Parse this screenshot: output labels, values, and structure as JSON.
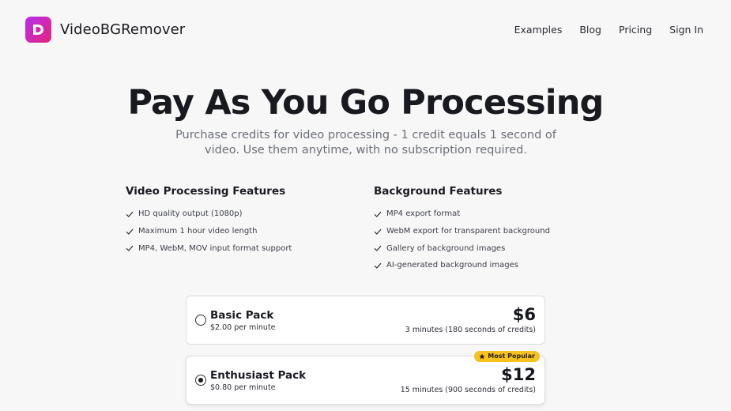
{
  "header": {
    "brand": "VideoBGRemover",
    "nav": [
      "Examples",
      "Blog",
      "Pricing",
      "Sign In"
    ]
  },
  "hero": {
    "title": "Pay As You Go Processing",
    "subtitle": "Purchase credits for video processing - 1 credit equals 1 second of video. Use them anytime, with no subscription required."
  },
  "features": {
    "video": {
      "title": "Video Processing Features",
      "items": [
        "HD quality output (1080p)",
        "Maximum 1 hour video length",
        "MP4, WebM, MOV input format support"
      ]
    },
    "background": {
      "title": "Background Features",
      "items": [
        "MP4 export format",
        "WebM export for transparent background",
        "Gallery of background images",
        "AI-generated background images"
      ]
    }
  },
  "packs": [
    {
      "name": "Basic Pack",
      "rate": "$2.00 per minute",
      "price": "$6",
      "credits": "3 minutes (180 seconds of credits)",
      "selected": false
    },
    {
      "name": "Enthusiast Pack",
      "rate": "$0.80 per minute",
      "price": "$12",
      "credits": "15 minutes (900 seconds of credits)",
      "selected": true,
      "badge": "Most Popular"
    }
  ],
  "colors": {
    "brand_gradient_start": "#b72cf0",
    "brand_gradient_end": "#e6247a",
    "badge": "#f6c21f"
  },
  "icons": {
    "logo": "brand-logo-icon",
    "feature_bullet": "check-icon",
    "badge": "star-icon",
    "selection": "radio-icon"
  }
}
